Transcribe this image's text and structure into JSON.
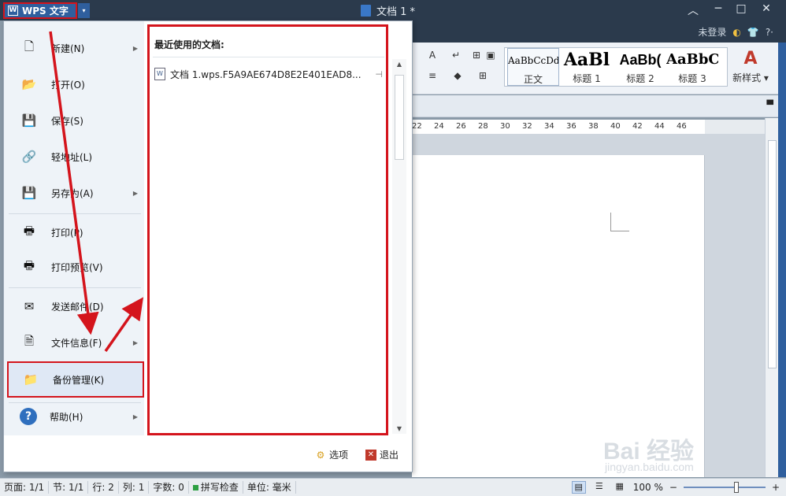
{
  "titlebar": {
    "app_name": "WPS 文字",
    "logo_letter": "W",
    "doc_title": "文档 1 *",
    "dropdown_arrow": "▾",
    "minimize": "︿",
    "restore": "─",
    "maximize": "□",
    "close": "✕"
  },
  "user_area": {
    "login": "未登录",
    "help": "?·"
  },
  "styles": {
    "items": [
      {
        "sample": "AaBbCcDd",
        "name": "正文"
      },
      {
        "sample": "AaBl",
        "name": "标题 1"
      },
      {
        "sample": "AaBb(",
        "name": "标题 2"
      },
      {
        "sample": "AaBbC",
        "name": "标题 3"
      }
    ],
    "new_style_label": "新样式 ▾",
    "new_style_glyph": "A"
  },
  "ruler": {
    "ticks": [
      "22",
      "24",
      "26",
      "28",
      "30",
      "32",
      "34",
      "36",
      "38",
      "40",
      "42",
      "44",
      "46"
    ]
  },
  "menu": {
    "items": [
      {
        "label": "新建(N)",
        "icon": "new-doc-icon",
        "glyph": "🗋",
        "has_submenu": true
      },
      {
        "label": "打开(O)",
        "icon": "open-folder-icon",
        "glyph": "📂",
        "has_submenu": false
      },
      {
        "label": "保存(S)",
        "icon": "save-icon",
        "glyph": "💾",
        "has_submenu": false
      },
      {
        "label": "轻地址(L)",
        "icon": "link-icon",
        "glyph": "🔗",
        "has_submenu": false
      },
      {
        "label": "另存为(A)",
        "icon": "save-as-icon",
        "glyph": "💾",
        "has_submenu": true
      },
      {
        "label": "打印(P)",
        "icon": "print-icon",
        "glyph": "🖶",
        "has_submenu": false
      },
      {
        "label": "打印预览(V)",
        "icon": "print-preview-icon",
        "glyph": "🖶",
        "has_submenu": false
      },
      {
        "label": "发送邮件(D)",
        "icon": "mail-icon",
        "glyph": "✉",
        "has_submenu": false
      },
      {
        "label": "文件信息(F)",
        "icon": "file-info-icon",
        "glyph": "🗎",
        "has_submenu": true
      },
      {
        "label": "备份管理(K)",
        "icon": "backup-icon",
        "glyph": "📁",
        "has_submenu": false
      },
      {
        "label": "帮助(H)",
        "icon": "help-icon",
        "glyph": "?",
        "has_submenu": true
      }
    ],
    "submenu_arrow": "▶"
  },
  "recent": {
    "title": "最近使用的文档:",
    "files": [
      {
        "name": "文档 1.wps.F5A9AE674D8E2E401EAD8...",
        "pin": "⊣"
      }
    ],
    "file_glyph": "W"
  },
  "menu_bottom": {
    "options_label": "选项",
    "options_glyph": "⚙",
    "exit_label": "退出",
    "exit_glyph": "✕"
  },
  "statusbar": {
    "page": "页面: 1/1",
    "section": "节: 1/1",
    "row": "行: 2",
    "col": "列: 1",
    "words": "字数: 0",
    "spell": "拼写检查",
    "unit": "单位: 毫米",
    "zoom": "100 %",
    "zoom_minus": "−",
    "zoom_plus": "+"
  },
  "watermark": {
    "text": "Bai 经验",
    "sub": "jingyan.baidu.com"
  },
  "colors": {
    "highlight_red": "#d4141c",
    "title_bg": "#2b3a4c",
    "menu_bg": "#eef3f8"
  }
}
